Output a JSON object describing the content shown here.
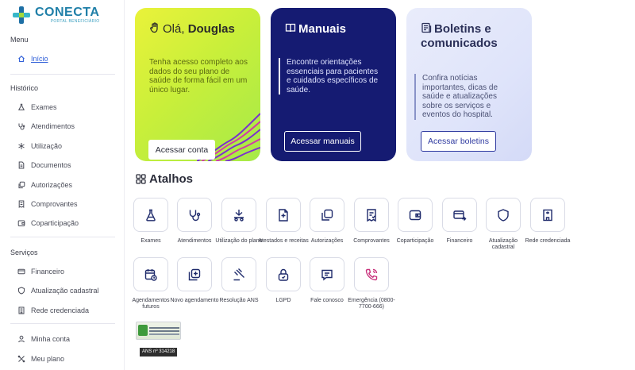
{
  "sidebar": {
    "logo": {
      "name": "CONECTA",
      "subtitle": "PORTAL BENEFICIÁRIO"
    },
    "menu_title": "Menu",
    "menu_items": [
      {
        "label": "Início",
        "icon": "home-icon",
        "active": true
      }
    ],
    "historico_title": "Histórico",
    "historico_items": [
      {
        "label": "Exames",
        "icon": "flask-icon"
      },
      {
        "label": "Atendimentos",
        "icon": "stethoscope-icon"
      },
      {
        "label": "Utilização",
        "icon": "star-icon"
      },
      {
        "label": "Documentos",
        "icon": "document-icon"
      },
      {
        "label": "Autorizações",
        "icon": "copy-icon"
      },
      {
        "label": "Comprovantes",
        "icon": "receipt-icon"
      },
      {
        "label": "Coparticipação",
        "icon": "wallet-icon"
      }
    ],
    "servicos_title": "Serviços",
    "servicos_items": [
      {
        "label": "Financeiro",
        "icon": "card-icon"
      },
      {
        "label": "Atualização cadastral",
        "icon": "shield-icon"
      },
      {
        "label": "Rede credenciada",
        "icon": "building-icon"
      }
    ],
    "account_items": [
      {
        "label": "Minha conta",
        "icon": "user-icon"
      },
      {
        "label": "Meu plano",
        "icon": "plan-icon"
      }
    ]
  },
  "cards": {
    "ola": {
      "greeting": "Olá, ",
      "user": "Douglas",
      "text": "Tenha acesso completo aos dados do seu plano de saúde de forma fácil em um único lugar.",
      "cta": "Acessar conta"
    },
    "manuais": {
      "title": "Manuais",
      "text": "Encontre orientações essenciais para pacientes e cuidados específicos de saúde.",
      "cta": "Acessar manuais"
    },
    "boletins": {
      "title": "Boletins e comunicados",
      "text": "Confira notícias importantes, dicas de saúde e atualizações sobre os serviços e eventos do hospital.",
      "cta": "Acessar boletins"
    }
  },
  "atalhos": {
    "title": "Atalhos",
    "items": [
      {
        "label": "Exames",
        "icon": "flask-icon"
      },
      {
        "label": "Atendimentos",
        "icon": "stethoscope-icon"
      },
      {
        "label": "Utilização do plano",
        "icon": "usage-icon"
      },
      {
        "label": "Atestados e receitas",
        "icon": "prescription-icon"
      },
      {
        "label": "Autorizações",
        "icon": "copy-icon"
      },
      {
        "label": "Comprovantes",
        "icon": "receipt-icon"
      },
      {
        "label": "Coparticipação",
        "icon": "wallet-icon"
      },
      {
        "label": "Financeiro",
        "icon": "card-icon"
      },
      {
        "label": "Atualização cadastral",
        "icon": "shield-icon"
      },
      {
        "label": "Rede credenciada",
        "icon": "building-icon"
      },
      {
        "label": "Agendamentos futuros",
        "icon": "calendar-clock-icon"
      },
      {
        "label": "Novo agendamento",
        "icon": "add-schedule-icon"
      },
      {
        "label": "Resolução ANS",
        "icon": "gavel-icon"
      },
      {
        "label": "LGPD",
        "icon": "lock-icon"
      },
      {
        "label": "Fale conosco",
        "icon": "chat-icon"
      },
      {
        "label": "Emergência (0800-7700-666)",
        "icon": "phone-icon"
      }
    ]
  },
  "ans": {
    "logo_text": "ANS Agência Nacional de Saúde Suplementar",
    "registro": "ANS nº 314218"
  },
  "colors": {
    "accent": "#2f5fd8",
    "manuais_bg": "#151b72",
    "ola_bg": "#d6f03a",
    "boletins_bg": "#dfe4fa",
    "icon_stroke": "#1e2a6b"
  }
}
